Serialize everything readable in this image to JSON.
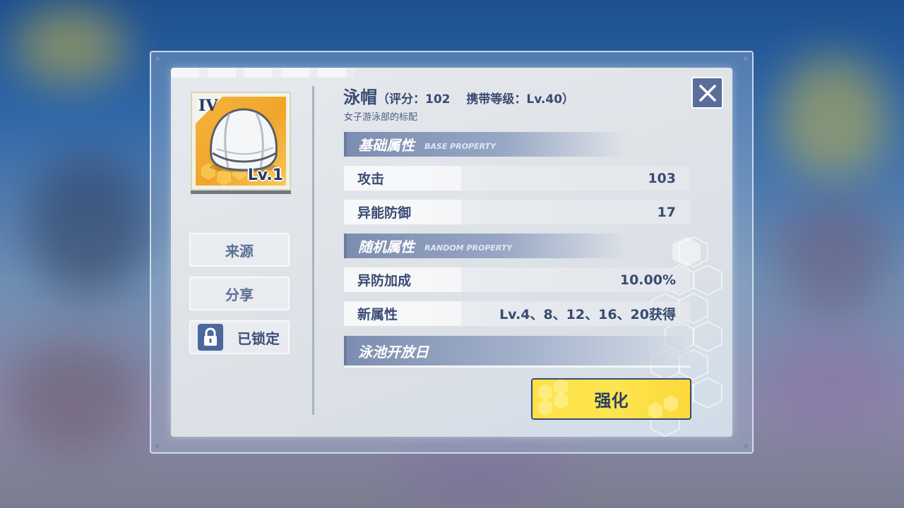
{
  "item": {
    "name": "泳帽",
    "meta": "（评分：102　 携带等级：Lv.40）",
    "description": "女子游泳部的标配",
    "tier": "IV",
    "level": "Lv.1"
  },
  "side_buttons": {
    "source": "来源",
    "share": "分享",
    "locked": "已锁定"
  },
  "sections": {
    "base": {
      "title": "基础属性",
      "subtitle": "BASE PROPERTY"
    },
    "random": {
      "title": "随机属性",
      "subtitle": "RANDOM PROPERTY"
    },
    "set_name": "泳池开放日"
  },
  "base_stats": [
    {
      "label": "攻击",
      "value": "103"
    },
    {
      "label": "异能防御",
      "value": "17"
    }
  ],
  "random_stats": [
    {
      "label": "异防加成",
      "value": "10.00%"
    },
    {
      "label": "新属性",
      "value": "Lv.4、8、12、16、20获得"
    }
  ],
  "actions": {
    "enhance": "强化"
  },
  "icons": {
    "close": "close-icon",
    "lock": "lock-icon",
    "item": "swim-cap-icon"
  },
  "colors": {
    "accent_blue": "#3a4a72",
    "enhance_yellow": "#fde146",
    "card_orange": "#f0a52a"
  }
}
